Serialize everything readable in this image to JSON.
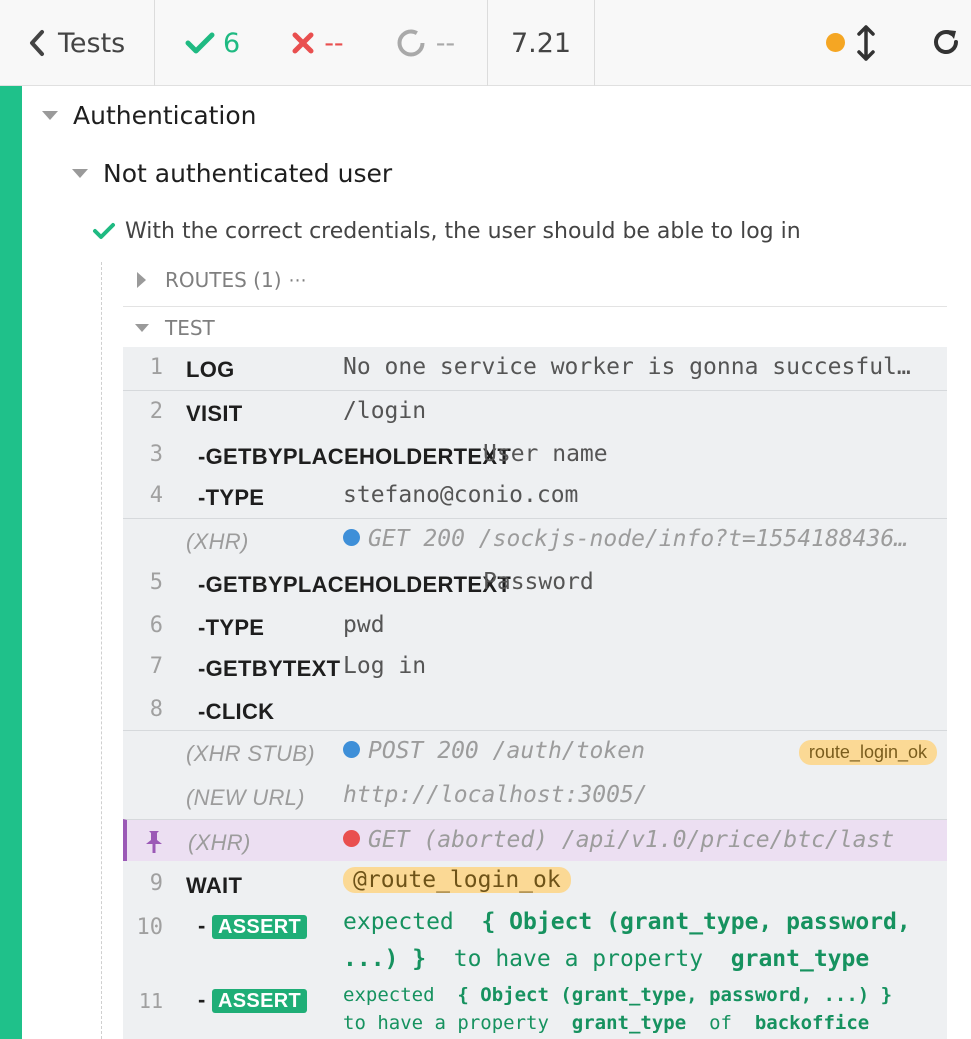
{
  "header": {
    "back_label": "Tests",
    "passed": "6",
    "failed": "--",
    "pending": "--",
    "duration": "7.21",
    "colors": {
      "passed": "#1fba82",
      "failed": "#e94f4f",
      "pending": "#a9a9a9",
      "running_dot": "#f5a623"
    }
  },
  "suites": {
    "level1": "Authentication",
    "level2": "Not authenticated user",
    "test_title": "With the correct credentials, the user should be able to log in"
  },
  "sections": {
    "routes": "ROUTES (1)",
    "routes_more": "⋯",
    "test": "TEST"
  },
  "commands": [
    {
      "num": "1",
      "name": "LOG",
      "message": "No one service worker is gonna succesful…"
    },
    {
      "num": "2",
      "name": "VISIT",
      "message": "/login"
    },
    {
      "num": "3",
      "name": "-GETBYPLACEHOLDERTEXT",
      "message": "User name"
    },
    {
      "num": "4",
      "name": "-TYPE",
      "message": "stefano@conio.com"
    },
    {
      "num": "",
      "name": "(XHR)",
      "message": "GET 200 /sockjs-node/info?t=1554188436…"
    },
    {
      "num": "5",
      "name": "-GETBYPLACEHOLDERTEXT",
      "message": "Password"
    },
    {
      "num": "6",
      "name": "-TYPE",
      "message": "pwd"
    },
    {
      "num": "7",
      "name": "-GETBYTEXT",
      "message": "Log in"
    },
    {
      "num": "8",
      "name": "-CLICK",
      "message": ""
    },
    {
      "num": "",
      "name": "(XHR STUB)",
      "message": "POST 200 /auth/token",
      "alias": "route_login_ok"
    },
    {
      "num": "",
      "name": "(NEW URL)",
      "message": "http://localhost:3005/"
    },
    {
      "num": "",
      "name": "(XHR)",
      "message": "GET (aborted) /api/v1.0/price/btc/last"
    },
    {
      "num": "9",
      "name": "WAIT",
      "message": "@route_login_ok"
    },
    {
      "num": "10",
      "name": "ASSERT",
      "message_line1_a": "expected",
      "message_line1_b": "{ Object (grant_type, password,",
      "message_line2_a": "...) }",
      "message_line2_b": "to have a property",
      "message_line2_c": "grant_type"
    },
    {
      "num": "11",
      "name": "ASSERT",
      "message_line1_a": "expected",
      "message_line1_b": "{ Object (grant_type, password, ...) }",
      "message_line2_a": "to have a property",
      "message_line2_b": "grant_type",
      "message_line2_c": "of",
      "message_line2_d": "backoffice"
    }
  ]
}
